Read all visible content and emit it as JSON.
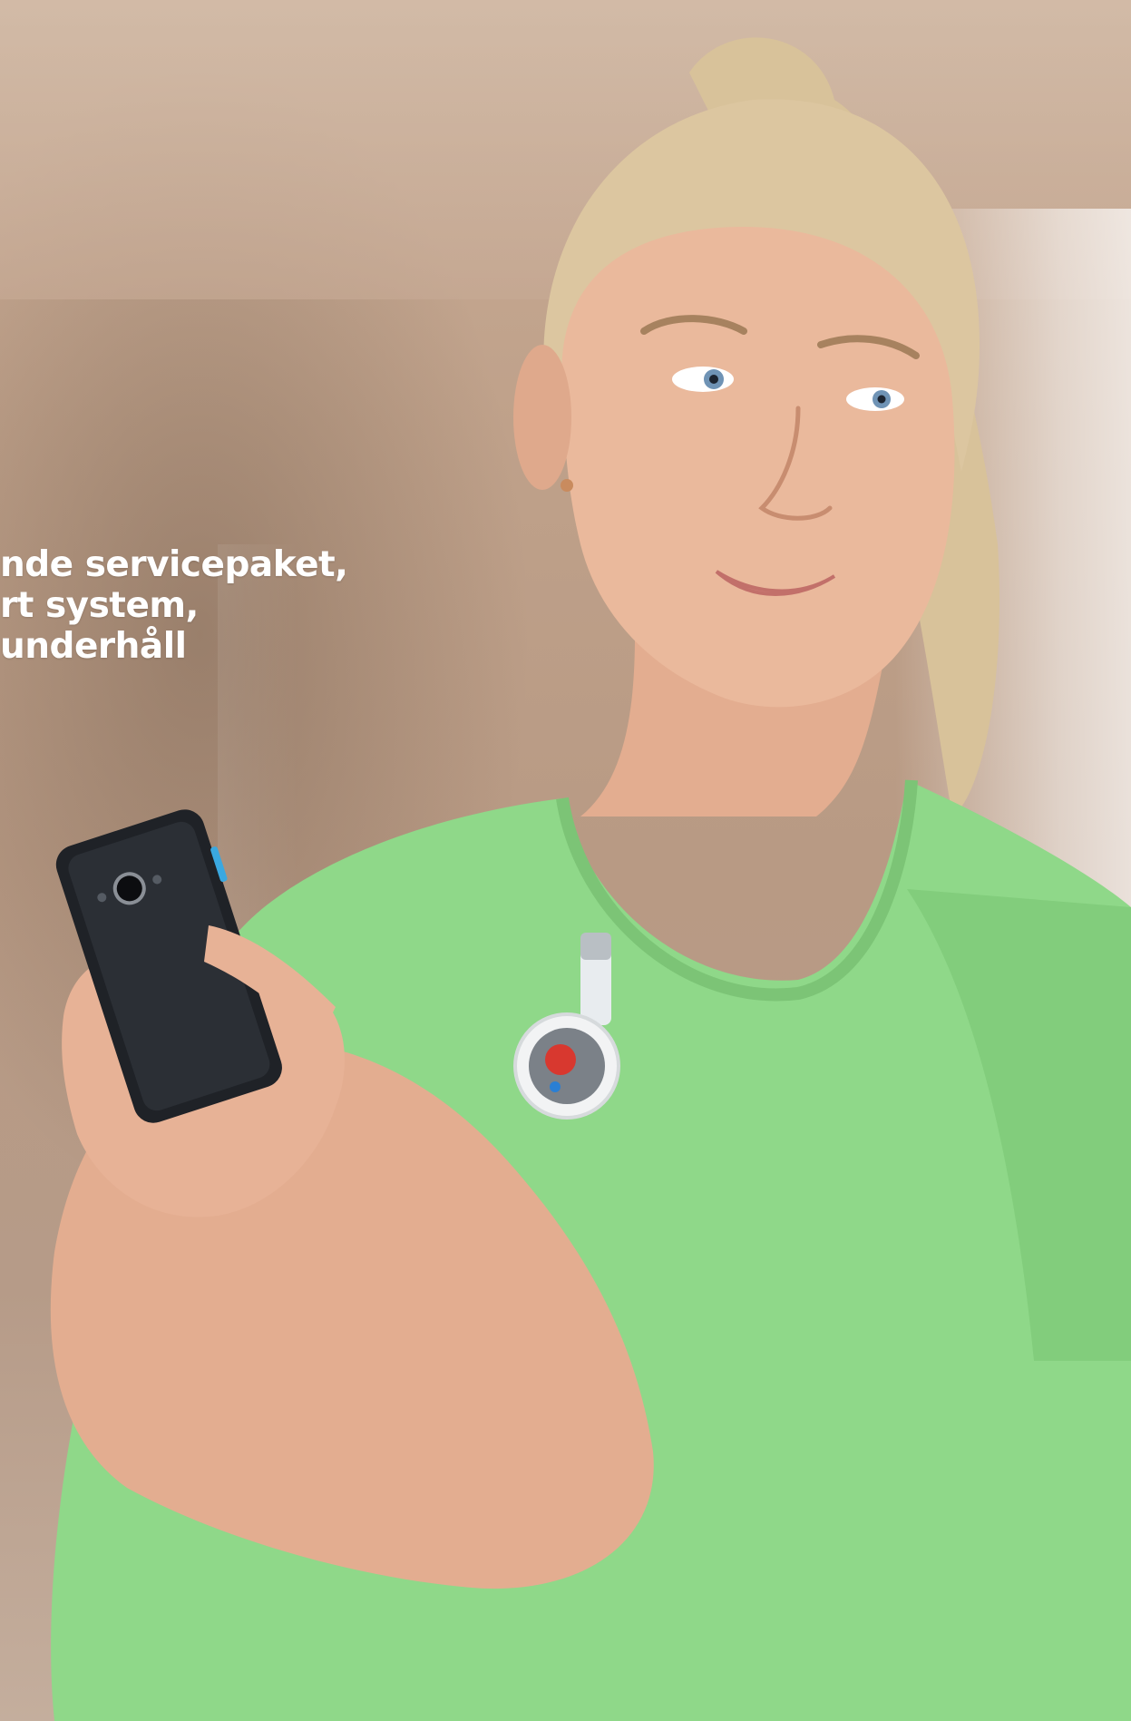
{
  "headline": {
    "line1": "nde servicepaket,",
    "line2": "rt system,",
    "line3": "underhåll"
  },
  "colors": {
    "shirt": "#8fd889",
    "skin": "#e8b49a",
    "hair": "#e2cfa8",
    "background": "#bfa18a",
    "text": "#ffffff"
  }
}
